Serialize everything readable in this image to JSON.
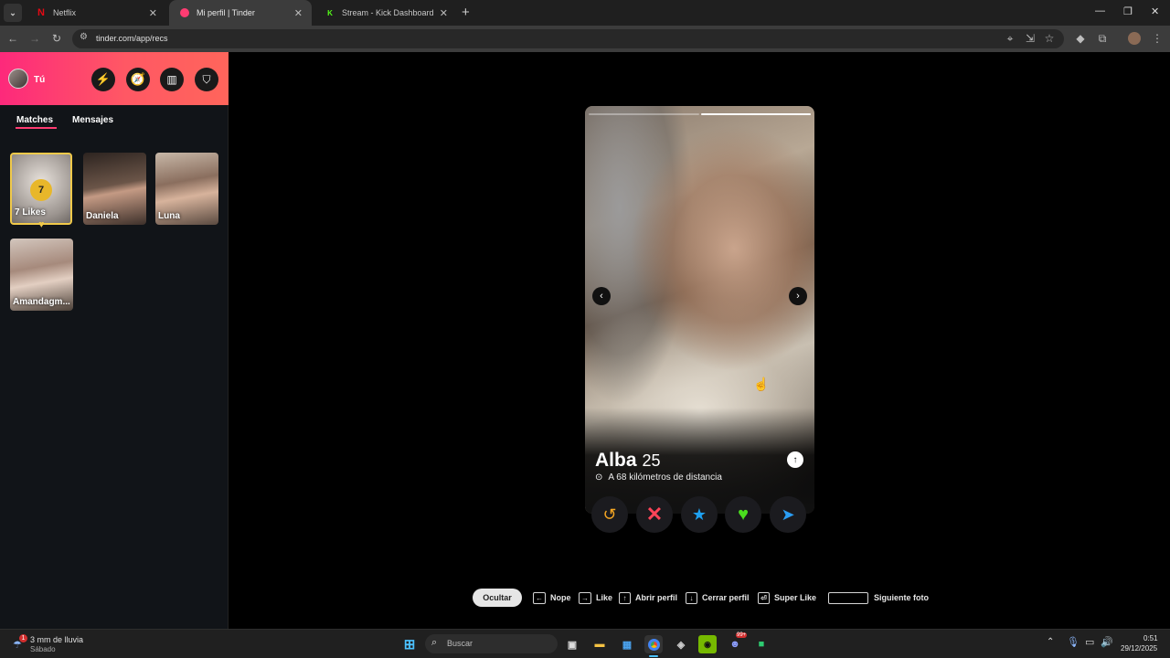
{
  "browser": {
    "tabs": [
      {
        "title": "Netflix",
        "icon": "netflix-icon",
        "active": false
      },
      {
        "title": "Mi perfil | Tinder",
        "icon": "tinder-icon",
        "active": true
      },
      {
        "title": "Stream - Kick Dashboard",
        "icon": "kick-icon",
        "active": false
      }
    ],
    "url": "tinder.com/app/recs"
  },
  "sidebar": {
    "user_label": "Tú",
    "tabs": [
      "Matches",
      "Mensajes"
    ],
    "likes_count": "7",
    "likes_label": "7 Likes",
    "matches": [
      {
        "name": "Daniela"
      },
      {
        "name": "Luna"
      },
      {
        "name": "Amandagm..."
      }
    ]
  },
  "profile": {
    "name": "Alba",
    "age": "25",
    "distance": "A 68 kilómetros de distancia",
    "photo_count": 2,
    "current_photo": 1
  },
  "shortcuts": {
    "hide": "Ocultar",
    "nope": "Nope",
    "like": "Like",
    "open_profile": "Abrir perfil",
    "close_profile": "Cerrar perfil",
    "super_like": "Super Like",
    "next_photo": "Siguiente foto"
  },
  "taskbar": {
    "weather_badge": "1",
    "weather": "3 mm de lluvia",
    "weather_sub": "Sábado",
    "search_placeholder": "Buscar",
    "time": "0:51",
    "date": "29/12/2025",
    "discord_badge": "99+"
  },
  "colors": {
    "tinder_gradient_start": "#fd297b",
    "tinder_gradient_end": "#ff655b",
    "nope": "#ff4458",
    "superlike": "#1ea1f1",
    "like": "#4ade1e",
    "rewind": "#f5a623",
    "boost": "#2a9df4"
  }
}
